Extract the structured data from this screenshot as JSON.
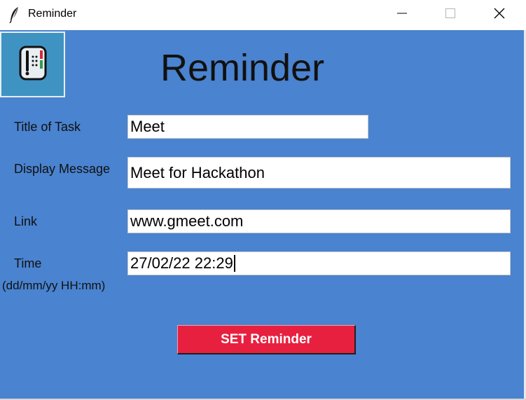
{
  "window": {
    "title": "Reminder",
    "icon": "feather-icon"
  },
  "title_controls": {
    "minimize": "minimize-icon",
    "maximize": "maximize-icon",
    "close": "close-icon"
  },
  "app": {
    "heading": "Reminder",
    "logo_icon": "reminder-app-icon"
  },
  "form": {
    "title_label": "Title of Task",
    "title_value": "Meet",
    "message_label": "Display Message",
    "message_value": "Meet for Hackathon",
    "link_label": "Link",
    "link_value": "www.gmeet.com",
    "time_label": "Time",
    "time_hint": "(dd/mm/yy HH:mm)",
    "time_value": "27/02/22 22:29",
    "submit_label": "SET Reminder"
  },
  "colors": {
    "background": "#4a83cf",
    "button": "#e8203f",
    "logo_background": "#3f93c3"
  }
}
